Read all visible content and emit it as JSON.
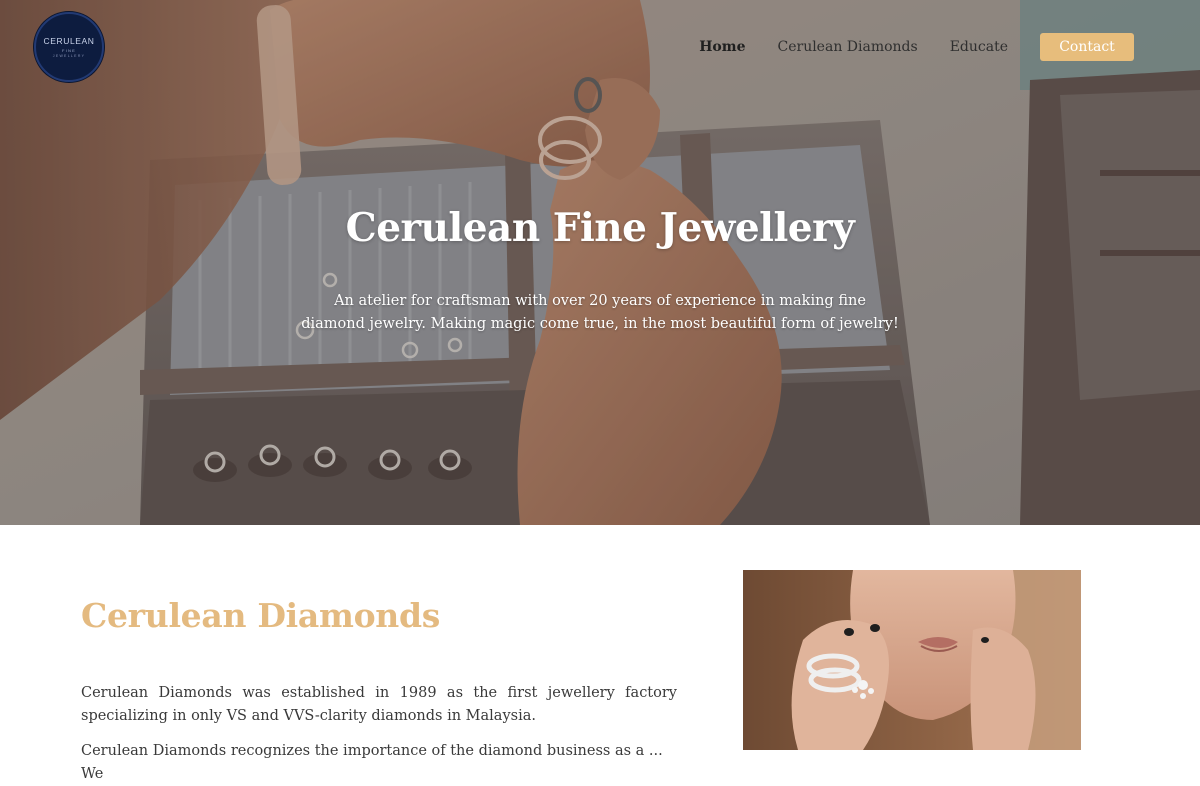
{
  "brand": {
    "logo_text": "CERULEAN",
    "logo_sub": "FINE",
    "logo_sub2": "JEWELLERY",
    "accent_color": "#e7bd7c",
    "logo_color": "#0d1c3f"
  },
  "nav": {
    "items": [
      {
        "label": "Home",
        "active": true
      },
      {
        "label": "Cerulean Diamonds",
        "active": false
      },
      {
        "label": "Educate",
        "active": false
      }
    ],
    "contact_label": "Contact"
  },
  "hero": {
    "title": "Cerulean Fine Jewellery",
    "subtitle": "An atelier for craftsman with over 20 years of experience in making fine diamond jewelry. Making magic come true, in the most beautiful form of jewelry!"
  },
  "about": {
    "heading": "Cerulean Diamonds",
    "paragraph1": "Cerulean Diamonds was established in 1989 as the first jewellery factory specializing in only VS and VVS-clarity diamonds in Malaysia.",
    "paragraph2": "Cerulean Diamonds recognizes the importance of the diamond business as a ... We"
  }
}
